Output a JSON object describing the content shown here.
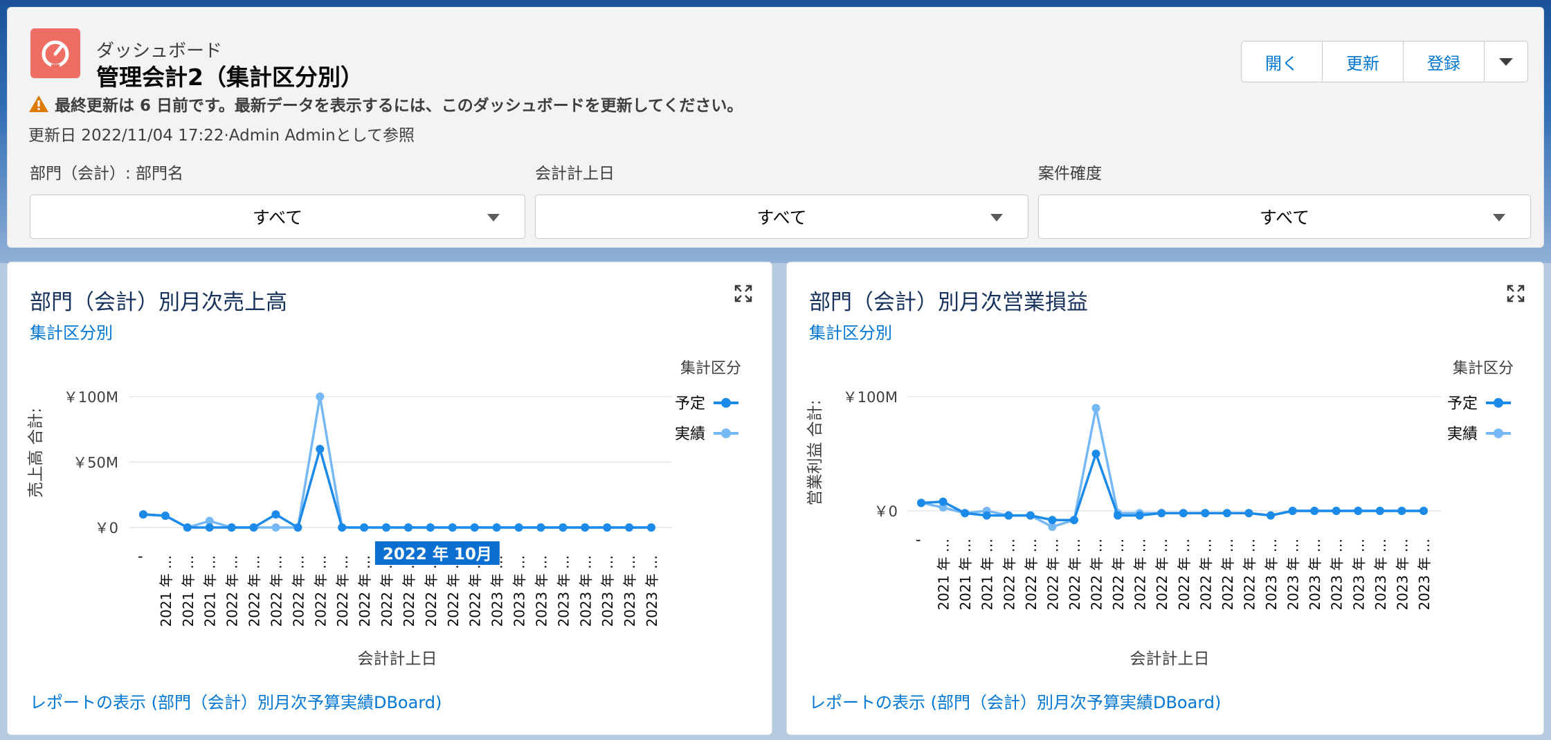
{
  "header": {
    "object_label": "ダッシュボード",
    "title": "管理会計2（集計区分別）",
    "warning": "最終更新は 6 日前です。最新データを表示するには、このダッシュボードを更新してください。",
    "updated": "更新日 2022/11/04 17:22·Admin Adminとして参照",
    "buttons": {
      "open": "開く",
      "refresh": "更新",
      "subscribe": "登録"
    },
    "filters": [
      {
        "label": "部門（会計）: 部門名",
        "value": "すべて"
      },
      {
        "label": "会計計上日",
        "value": "すべて"
      },
      {
        "label": "案件確度",
        "value": "すべて"
      }
    ]
  },
  "colors": {
    "plan": "#1b8ae8",
    "actual": "#76b8f5",
    "accent": "#0176d3",
    "tooltip": "#0a6fd1",
    "icon": "#ef6e64"
  },
  "chart_data": [
    {
      "type": "line",
      "title": "部門（会計）別月次売上高",
      "subtitle": "集計区分別",
      "xlabel": "会計計上日",
      "ylabel": "売上高 合計:",
      "yticks": [
        "￥100M",
        "￥50M",
        "￥0"
      ],
      "ylim": [
        -4,
        100
      ],
      "legend_title": "集計区分",
      "legend_placement": "top-right",
      "x": [
        "'",
        "2021 年 …",
        "2021 年 …",
        "2021 年 …",
        "2022 年 …",
        "2022 年 …",
        "2022 年 …",
        "2022 年 …",
        "2022 年 …",
        "2022 年 …",
        "2022 年 …",
        "2022 年 …",
        "2022 年 …",
        "2022 年 …",
        "2022 年 …",
        "2022 年 …",
        "2023 年 …",
        "2023 年 …",
        "2023 年 …",
        "2023 年 …",
        "2023 年 …",
        "2023 年 …",
        "2023 年 …",
        "2023 年 …"
      ],
      "series": [
        {
          "name": "予定",
          "values": [
            10,
            9,
            0,
            0,
            0,
            0,
            10,
            0,
            60,
            0,
            0,
            0,
            0,
            0,
            0,
            0,
            0,
            0,
            0,
            0,
            0,
            0,
            0,
            0
          ]
        },
        {
          "name": "実績",
          "values": [
            10,
            9,
            0,
            5,
            0,
            0,
            0,
            0,
            100,
            0,
            0,
            0,
            0,
            0,
            0,
            0,
            0,
            0,
            0,
            0,
            0,
            0,
            0,
            0
          ]
        }
      ],
      "tooltip": "2022 年 10月",
      "link": "レポートの表示 (部門（会計）別月次予算実績DBoard)"
    },
    {
      "type": "line",
      "title": "部門（会計）別月次営業損益",
      "subtitle": "集計区分別",
      "xlabel": "会計計上日",
      "ylabel": "営業利益 合計:",
      "yticks": [
        "￥100M",
        "￥0"
      ],
      "ylim": [
        -20,
        100
      ],
      "legend_title": "集計区分",
      "legend_placement": "top-right",
      "x": [
        "'",
        "2021 年 …",
        "2021 年 …",
        "2021 年 …",
        "2022 年 …",
        "2022 年 …",
        "2022 年 …",
        "2022 年 …",
        "2022 年 …",
        "2022 年 …",
        "2022 年 …",
        "2022 年 …",
        "2022 年 …",
        "2022 年 …",
        "2022 年 …",
        "2022 年 …",
        "2023 年 …",
        "2023 年 …",
        "2023 年 …",
        "2023 年 …",
        "2023 年 …",
        "2023 年 …",
        "2023 年 …",
        "2023 年 …"
      ],
      "series": [
        {
          "name": "予定",
          "values": [
            7,
            8,
            -2,
            -4,
            -4,
            -4,
            -8,
            -8,
            50,
            -4,
            -4,
            -2,
            -2,
            -2,
            -2,
            -2,
            -4,
            0,
            0,
            0,
            0,
            0,
            0,
            0
          ]
        },
        {
          "name": "実績",
          "values": [
            7,
            3,
            -2,
            0,
            -4,
            -4,
            -14,
            -8,
            90,
            -2,
            -2,
            -2,
            -2,
            -2,
            -2,
            -2,
            -4,
            0,
            0,
            0,
            0,
            0,
            0,
            0
          ]
        }
      ],
      "link": "レポートの表示 (部門（会計）別月次予算実績DBoard)"
    }
  ]
}
